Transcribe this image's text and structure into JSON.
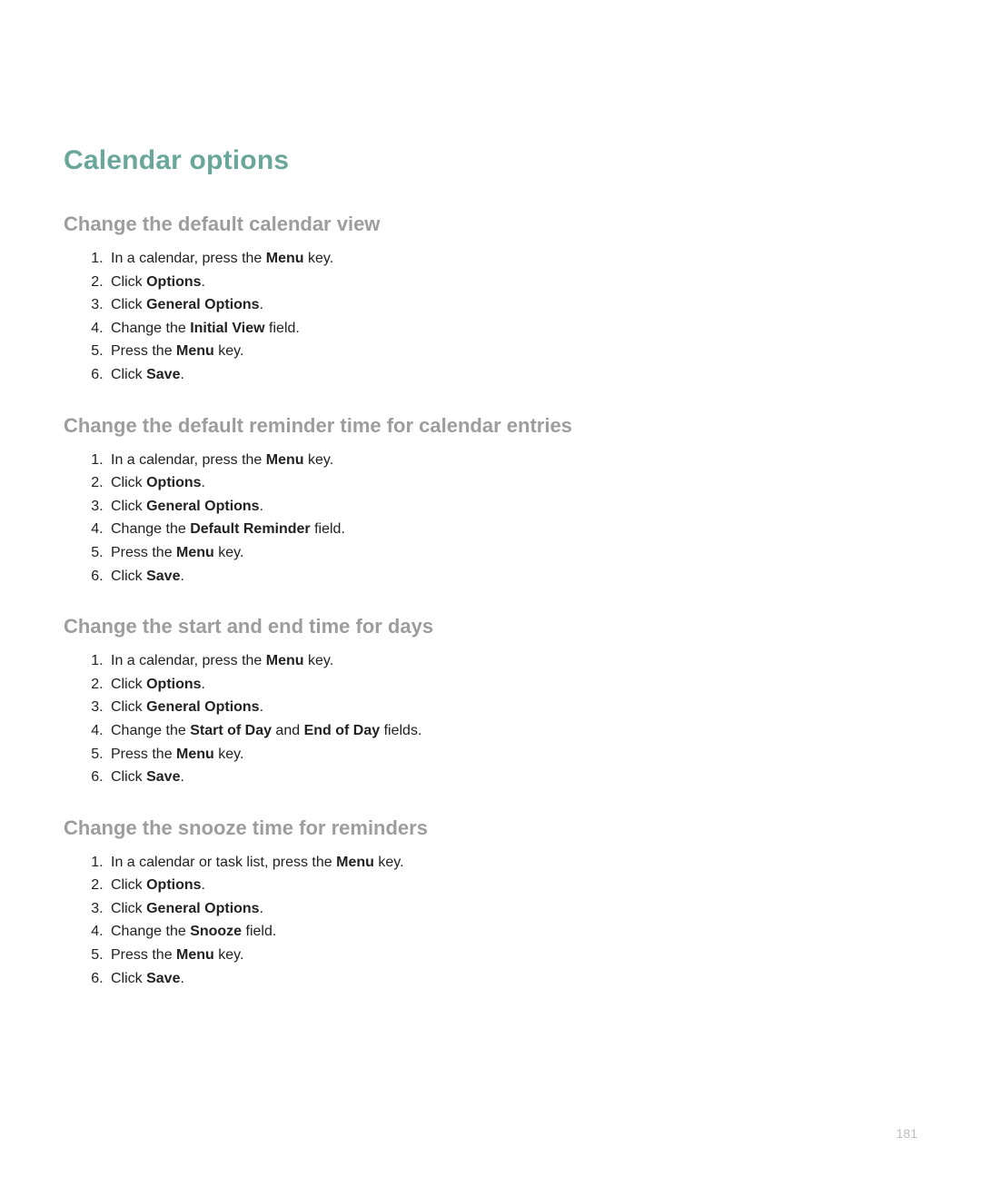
{
  "page_number": "181",
  "section_title": "Calendar options",
  "subsections": [
    {
      "title": "Change the default calendar view",
      "steps": [
        [
          {
            "t": "In a calendar, press the "
          },
          {
            "t": "Menu",
            "b": true
          },
          {
            "t": " key."
          }
        ],
        [
          {
            "t": "Click "
          },
          {
            "t": "Options",
            "b": true
          },
          {
            "t": "."
          }
        ],
        [
          {
            "t": "Click "
          },
          {
            "t": "General Options",
            "b": true
          },
          {
            "t": "."
          }
        ],
        [
          {
            "t": "Change the "
          },
          {
            "t": "Initial View",
            "b": true
          },
          {
            "t": " field."
          }
        ],
        [
          {
            "t": "Press the "
          },
          {
            "t": "Menu",
            "b": true
          },
          {
            "t": " key."
          }
        ],
        [
          {
            "t": "Click "
          },
          {
            "t": "Save",
            "b": true
          },
          {
            "t": "."
          }
        ]
      ]
    },
    {
      "title": "Change the default reminder time for calendar entries",
      "steps": [
        [
          {
            "t": "In a calendar, press the "
          },
          {
            "t": "Menu",
            "b": true
          },
          {
            "t": " key."
          }
        ],
        [
          {
            "t": "Click "
          },
          {
            "t": "Options",
            "b": true
          },
          {
            "t": "."
          }
        ],
        [
          {
            "t": "Click "
          },
          {
            "t": "General Options",
            "b": true
          },
          {
            "t": "."
          }
        ],
        [
          {
            "t": "Change the "
          },
          {
            "t": "Default Reminder",
            "b": true
          },
          {
            "t": " field."
          }
        ],
        [
          {
            "t": "Press the "
          },
          {
            "t": "Menu",
            "b": true
          },
          {
            "t": " key."
          }
        ],
        [
          {
            "t": "Click "
          },
          {
            "t": "Save",
            "b": true
          },
          {
            "t": "."
          }
        ]
      ]
    },
    {
      "title": "Change the start and end time for days",
      "steps": [
        [
          {
            "t": "In a calendar, press the "
          },
          {
            "t": "Menu",
            "b": true
          },
          {
            "t": " key."
          }
        ],
        [
          {
            "t": "Click "
          },
          {
            "t": "Options",
            "b": true
          },
          {
            "t": "."
          }
        ],
        [
          {
            "t": "Click "
          },
          {
            "t": "General Options",
            "b": true
          },
          {
            "t": "."
          }
        ],
        [
          {
            "t": "Change the "
          },
          {
            "t": "Start of Day",
            "b": true
          },
          {
            "t": " and "
          },
          {
            "t": "End of Day",
            "b": true
          },
          {
            "t": " fields."
          }
        ],
        [
          {
            "t": "Press the "
          },
          {
            "t": "Menu",
            "b": true
          },
          {
            "t": " key."
          }
        ],
        [
          {
            "t": "Click "
          },
          {
            "t": "Save",
            "b": true
          },
          {
            "t": "."
          }
        ]
      ]
    },
    {
      "title": "Change the snooze time for reminders",
      "steps": [
        [
          {
            "t": "In a calendar or task list, press the "
          },
          {
            "t": "Menu",
            "b": true
          },
          {
            "t": " key."
          }
        ],
        [
          {
            "t": "Click "
          },
          {
            "t": "Options",
            "b": true
          },
          {
            "t": "."
          }
        ],
        [
          {
            "t": "Click "
          },
          {
            "t": "General Options",
            "b": true
          },
          {
            "t": "."
          }
        ],
        [
          {
            "t": "Change the "
          },
          {
            "t": "Snooze",
            "b": true
          },
          {
            "t": " field."
          }
        ],
        [
          {
            "t": "Press the "
          },
          {
            "t": "Menu",
            "b": true
          },
          {
            "t": " key."
          }
        ],
        [
          {
            "t": "Click "
          },
          {
            "t": "Save",
            "b": true
          },
          {
            "t": "."
          }
        ]
      ]
    }
  ]
}
